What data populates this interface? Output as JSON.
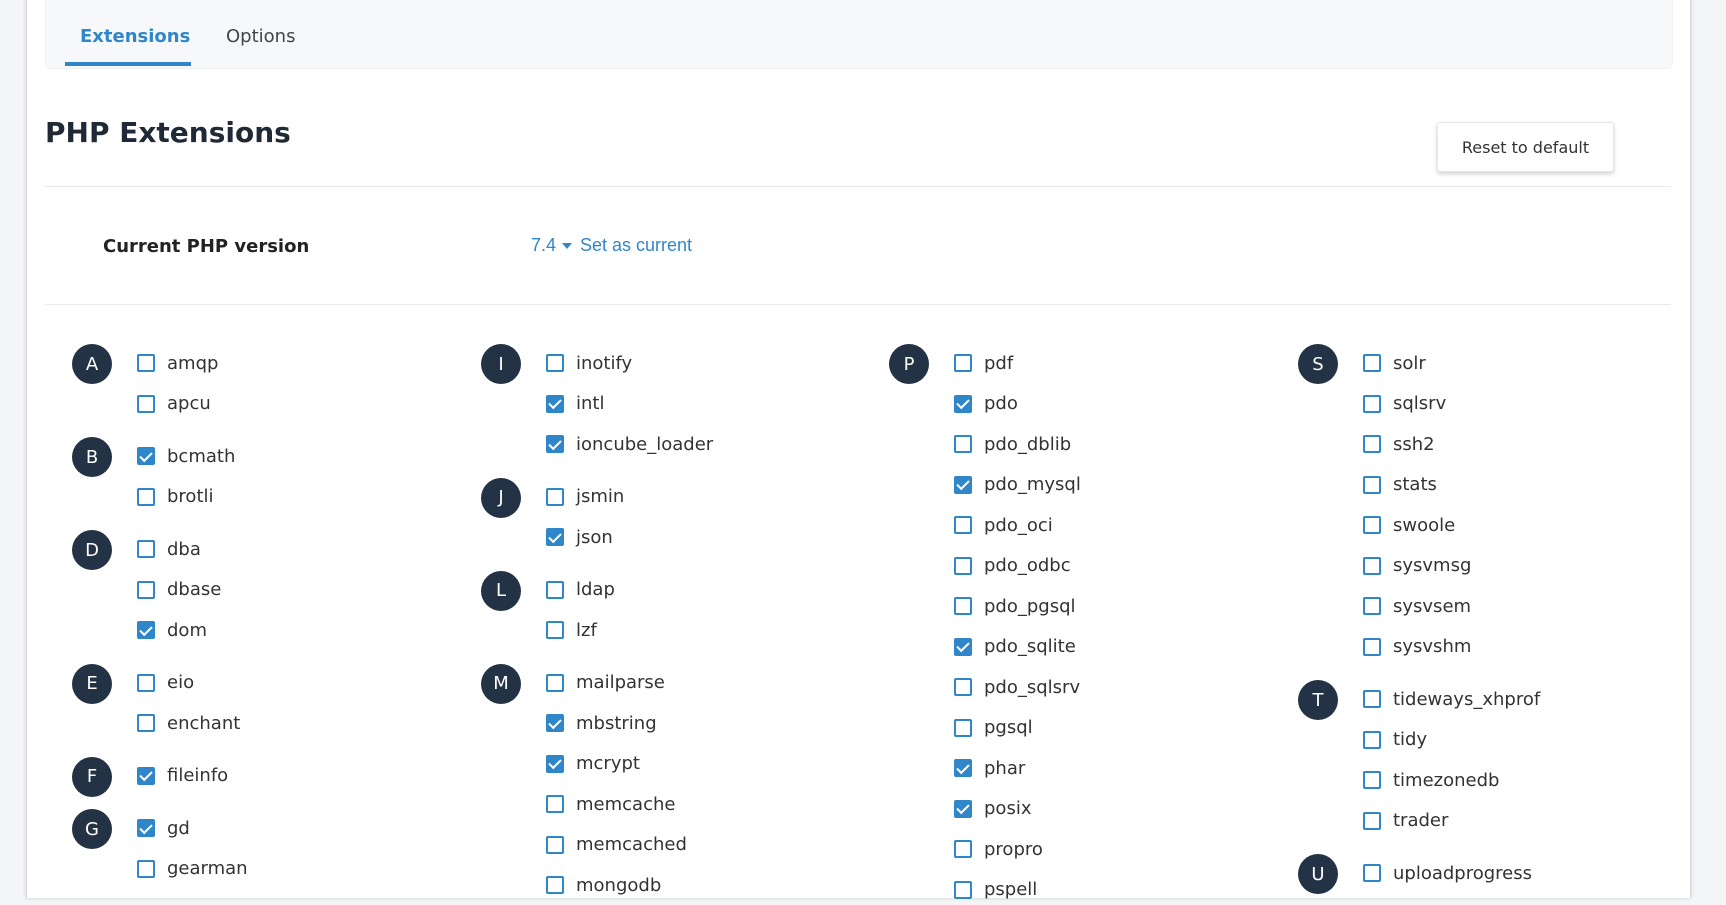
{
  "tabs": [
    {
      "label": "Extensions",
      "active": true
    },
    {
      "label": "Options",
      "active": false
    }
  ],
  "page_title": "PHP Extensions",
  "reset_button": "Reset to default",
  "current_version": {
    "label": "Current PHP version",
    "version": "7.4",
    "set_current": "Set as current"
  },
  "colors": {
    "accent": "#2f86c9",
    "badge_bg": "#233244"
  },
  "columns": [
    {
      "groups": [
        {
          "letter": "A",
          "items": [
            {
              "name": "amqp",
              "checked": false
            },
            {
              "name": "apcu",
              "checked": false
            }
          ]
        },
        {
          "letter": "B",
          "items": [
            {
              "name": "bcmath",
              "checked": true
            },
            {
              "name": "brotli",
              "checked": false
            }
          ]
        },
        {
          "letter": "D",
          "items": [
            {
              "name": "dba",
              "checked": false
            },
            {
              "name": "dbase",
              "checked": false
            },
            {
              "name": "dom",
              "checked": true
            }
          ]
        },
        {
          "letter": "E",
          "items": [
            {
              "name": "eio",
              "checked": false
            },
            {
              "name": "enchant",
              "checked": false
            }
          ]
        },
        {
          "letter": "F",
          "items": [
            {
              "name": "fileinfo",
              "checked": true
            }
          ]
        },
        {
          "letter": "G",
          "items": [
            {
              "name": "gd",
              "checked": true
            },
            {
              "name": "gearman",
              "checked": false
            }
          ]
        }
      ]
    },
    {
      "groups": [
        {
          "letter": "I",
          "items": [
            {
              "name": "inotify",
              "checked": false
            },
            {
              "name": "intl",
              "checked": true
            },
            {
              "name": "ioncube_loader",
              "checked": true
            }
          ]
        },
        {
          "letter": "J",
          "items": [
            {
              "name": "jsmin",
              "checked": false
            },
            {
              "name": "json",
              "checked": true
            }
          ]
        },
        {
          "letter": "L",
          "items": [
            {
              "name": "ldap",
              "checked": false
            },
            {
              "name": "lzf",
              "checked": false
            }
          ]
        },
        {
          "letter": "M",
          "items": [
            {
              "name": "mailparse",
              "checked": false
            },
            {
              "name": "mbstring",
              "checked": true
            },
            {
              "name": "mcrypt",
              "checked": true
            },
            {
              "name": "memcache",
              "checked": false
            },
            {
              "name": "memcached",
              "checked": false
            },
            {
              "name": "mongodb",
              "checked": false
            }
          ]
        }
      ]
    },
    {
      "groups": [
        {
          "letter": "P",
          "items": [
            {
              "name": "pdf",
              "checked": false
            },
            {
              "name": "pdo",
              "checked": true
            },
            {
              "name": "pdo_dblib",
              "checked": false
            },
            {
              "name": "pdo_mysql",
              "checked": true
            },
            {
              "name": "pdo_oci",
              "checked": false
            },
            {
              "name": "pdo_odbc",
              "checked": false
            },
            {
              "name": "pdo_pgsql",
              "checked": false
            },
            {
              "name": "pdo_sqlite",
              "checked": true
            },
            {
              "name": "pdo_sqlsrv",
              "checked": false
            },
            {
              "name": "pgsql",
              "checked": false
            },
            {
              "name": "phar",
              "checked": true
            },
            {
              "name": "posix",
              "checked": true
            },
            {
              "name": "propro",
              "checked": false
            },
            {
              "name": "pspell",
              "checked": false
            }
          ]
        }
      ]
    },
    {
      "groups": [
        {
          "letter": "S",
          "items": [
            {
              "name": "solr",
              "checked": false
            },
            {
              "name": "sqlsrv",
              "checked": false
            },
            {
              "name": "ssh2",
              "checked": false
            },
            {
              "name": "stats",
              "checked": false
            },
            {
              "name": "swoole",
              "checked": false
            },
            {
              "name": "sysvmsg",
              "checked": false
            },
            {
              "name": "sysvsem",
              "checked": false
            },
            {
              "name": "sysvshm",
              "checked": false
            }
          ]
        },
        {
          "letter": "T",
          "items": [
            {
              "name": "tideways_xhprof",
              "checked": false
            },
            {
              "name": "tidy",
              "checked": false
            },
            {
              "name": "timezonedb",
              "checked": false
            },
            {
              "name": "trader",
              "checked": false
            }
          ]
        },
        {
          "letter": "U",
          "items": [
            {
              "name": "uploadprogress",
              "checked": false
            }
          ]
        }
      ]
    }
  ]
}
